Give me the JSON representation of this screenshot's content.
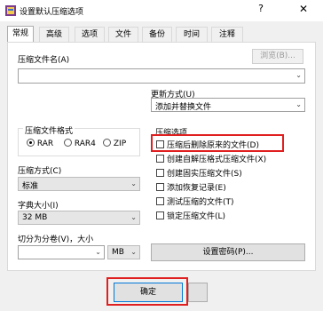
{
  "window": {
    "title": "设置默认压缩选项",
    "help": "?",
    "close": "✕"
  },
  "tabs": [
    "常规",
    "高级",
    "选项",
    "文件",
    "备份",
    "时间",
    "注释"
  ],
  "archive_name": {
    "label": "压缩文件名(A)",
    "browse": "浏览(B)..."
  },
  "update_mode": {
    "label": "更新方式(U)",
    "value": "添加并替换文件"
  },
  "format": {
    "label": "压缩文件格式",
    "options": [
      "RAR",
      "RAR4",
      "ZIP"
    ],
    "selected": "RAR"
  },
  "method": {
    "label": "压缩方式(C)",
    "value": "标准"
  },
  "dict": {
    "label": "字典大小(I)",
    "value": "32 MB"
  },
  "split": {
    "label": "切分为分卷(V)，大小",
    "value": "",
    "unit": "MB"
  },
  "options": {
    "label": "压缩选项",
    "items": [
      "压缩后删除原来的文件(D)",
      "创建自解压格式压缩文件(X)",
      "创建固实压缩文件(S)",
      "添加恢复记录(E)",
      "测试压缩的文件(T)",
      "锁定压缩文件(L)"
    ]
  },
  "password_button": "设置密码(P)...",
  "ok_button": "确定",
  "colors": {
    "highlight": "#e02020",
    "panel": "#ffffff",
    "window": "#f0f0f0"
  }
}
